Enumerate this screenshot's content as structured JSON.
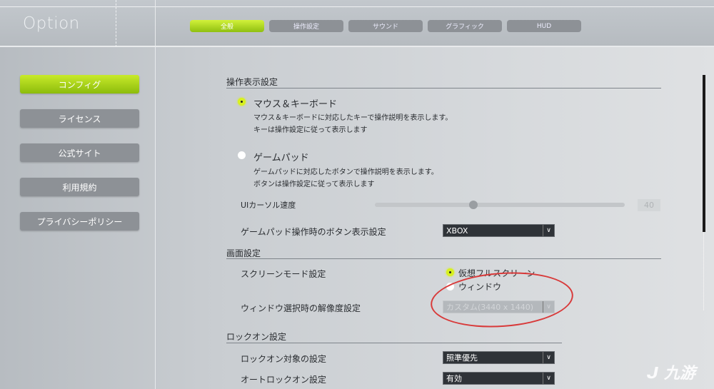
{
  "header": {
    "title": "Option",
    "tabs": [
      {
        "label": "全般",
        "active": true
      },
      {
        "label": "操作設定"
      },
      {
        "label": "サウンド"
      },
      {
        "label": "グラフィック"
      },
      {
        "label": "HUD"
      }
    ]
  },
  "sidebar": {
    "items": [
      {
        "label": "コンフィグ",
        "active": true
      },
      {
        "label": "ライセンス"
      },
      {
        "label": "公式サイト"
      },
      {
        "label": "利用規約"
      },
      {
        "label": "プライバシーポリシー"
      }
    ]
  },
  "sections": {
    "control_display": {
      "title": "操作表示設定",
      "mouse": {
        "label": "マウス＆キーボード",
        "selected": true,
        "desc1": "マウス＆キーボードに対応したキーで操作説明を表示します。",
        "desc2": "キーは操作設定に従って表示します"
      },
      "gamepad": {
        "label": "ゲームパッド",
        "selected": false,
        "desc1": "ゲームパッドに対応したボタンで操作説明を表示します。",
        "desc2": "ボタンは操作設定に従って表示します"
      },
      "cursor_speed": {
        "label": "UIカーソル速度",
        "value": "40",
        "percent": 39
      },
      "button_display": {
        "label": "ゲームパッド操作時のボタン表示設定",
        "value": "XBOX"
      }
    },
    "screen": {
      "title": "画面設定",
      "mode": {
        "label": "スクリーンモード設定",
        "options": [
          "仮想フルスクリーン",
          "ウィンドウ"
        ],
        "selected": "仮想フルスクリーン"
      },
      "resolution": {
        "label": "ウィンドウ選択時の解像度設定",
        "value": "カスタム(3440 x 1440)",
        "disabled": true
      }
    },
    "lockon": {
      "title": "ロックオン設定",
      "target": {
        "label": "ロックオン対象の設定",
        "value": "照準優先"
      },
      "auto": {
        "label": "オートロックオン設定",
        "value": "有効"
      }
    }
  },
  "annotation_color": "#d83a3a",
  "accent_color": "#b8e01e",
  "watermark": "九游"
}
